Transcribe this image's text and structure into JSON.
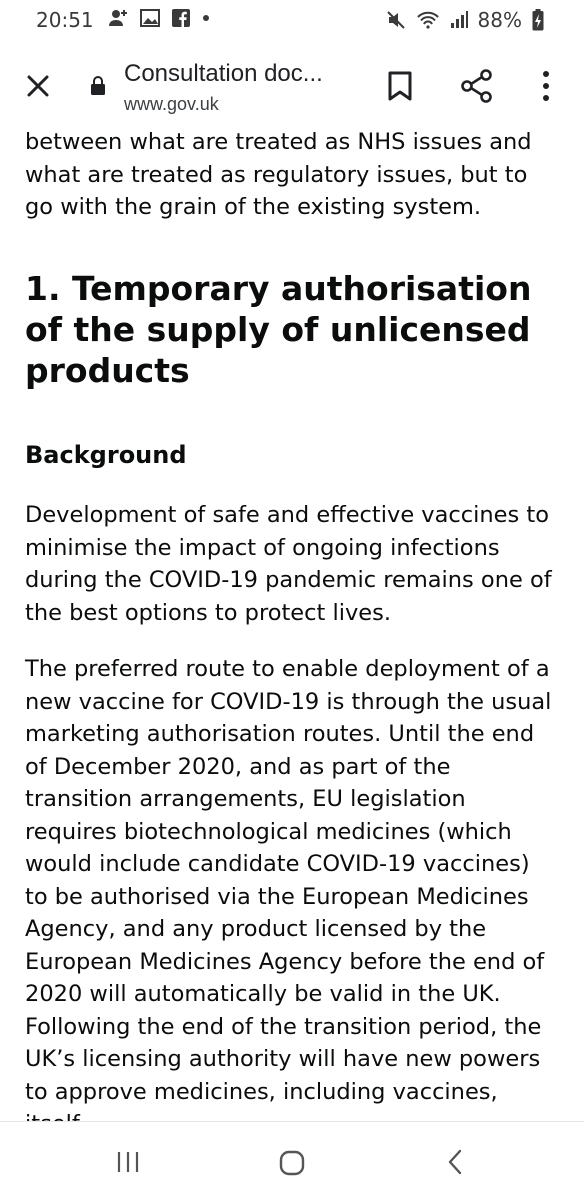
{
  "status_bar": {
    "time": "20:51",
    "battery_percent": "88%",
    "left_icons": [
      "person-add-icon",
      "image-icon",
      "facebook-icon",
      "dot-icon"
    ],
    "right_icons": [
      "mute-icon",
      "wifi-icon",
      "signal-icon",
      "battery-charging-icon"
    ]
  },
  "toolbar": {
    "title": "Consultation doc...",
    "url": "www.gov.uk",
    "icons": [
      "close-icon",
      "lock-icon",
      "bookmark-icon",
      "share-icon",
      "more-vert-icon"
    ]
  },
  "article": {
    "lead_text": "between what are treated as NHS issues and what are treated as regulatory issues, but to go with the grain of the existing system.",
    "section_heading": "1. Temporary authorisation of the supply of unlicensed products",
    "sub_heading": "Background",
    "paragraphs": [
      "Development of safe and effective vaccines to minimise the impact of ongoing infections during the COVID-19 pandemic remains one of the best options to protect lives.",
      "The preferred route to enable deployment of a new vaccine for COVID-19 is through the usual marketing authorisation routes. Until the end of December 2020, and as part of the transition arrangements, EU legislation requires biotechnological medicines (which would include candidate COVID-19 vaccines) to be authorised via the European Medicines Agency, and any product licensed by the European Medicines Agency before the end of 2020 will automatically be valid in the UK. Following the end of the transition period, the UK’s licensing authority will have new powers to approve medicines, including vaccines, itself."
    ]
  },
  "nav_bar": {
    "icons": [
      "recents-icon",
      "home-icon",
      "back-icon"
    ]
  }
}
